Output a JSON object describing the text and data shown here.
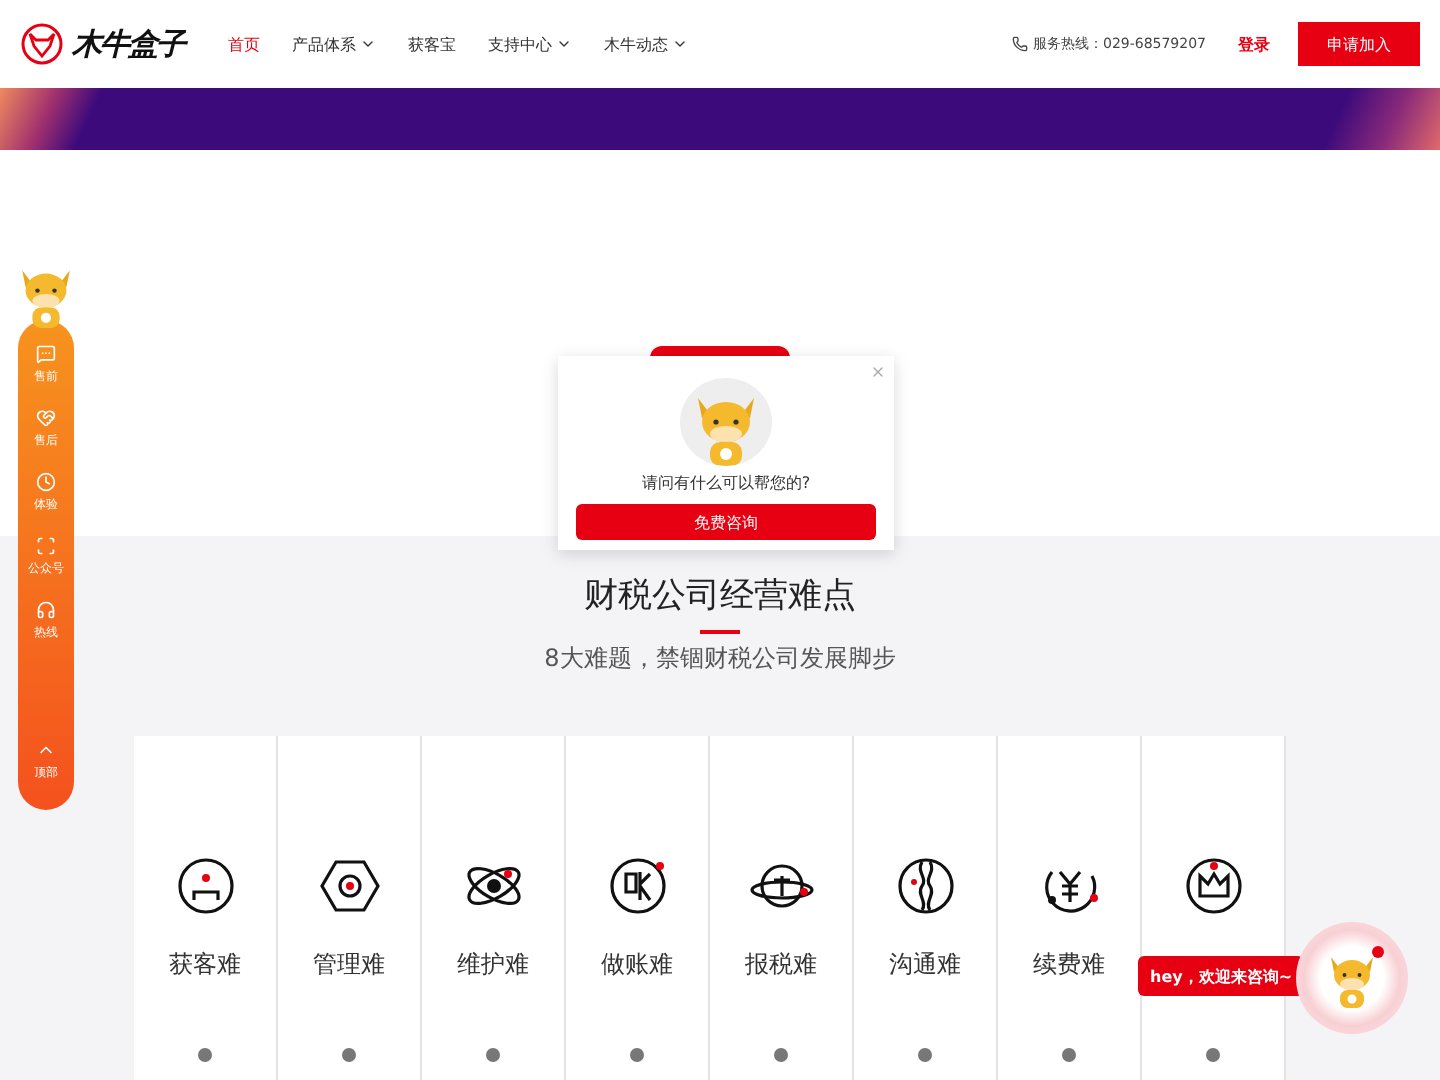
{
  "header": {
    "logo_text": "木牛盒子",
    "nav": [
      {
        "label": "首页",
        "selected": true,
        "dropdown": false
      },
      {
        "label": "产品体系",
        "selected": false,
        "dropdown": true
      },
      {
        "label": "获客宝",
        "selected": false,
        "dropdown": false
      },
      {
        "label": "支持中心",
        "selected": false,
        "dropdown": true
      },
      {
        "label": "木牛动态",
        "selected": false,
        "dropdown": true
      }
    ],
    "hotline": "服务热线：029-68579207",
    "login": "登录",
    "apply": "申请加入"
  },
  "sidebar": {
    "items": [
      {
        "label": "售前"
      },
      {
        "label": "售后"
      },
      {
        "label": "体验"
      },
      {
        "label": "公众号"
      },
      {
        "label": "热线"
      }
    ],
    "top": "顶部"
  },
  "popup": {
    "question": "请问有什么可以帮您的?",
    "button": "免费咨询"
  },
  "section": {
    "title": "财税公司经营难点",
    "subtitle": "8大难题，禁锢财税公司发展脚步",
    "cards": [
      {
        "kind": "labeled",
        "label": "获客难"
      },
      {
        "kind": "labeled",
        "label": "管理难"
      },
      {
        "kind": "labeled",
        "label": "维护难"
      },
      {
        "kind": "labeled",
        "label": "做账难"
      },
      {
        "kind": "labeled",
        "label": "报税难"
      },
      {
        "kind": "labeled",
        "label": "沟通难"
      },
      {
        "kind": "labeled",
        "label": "续费难"
      },
      {
        "kind": "covered"
      }
    ]
  },
  "chat": {
    "greeting": "hey，欢迎来咨询~",
    "unread": true
  }
}
